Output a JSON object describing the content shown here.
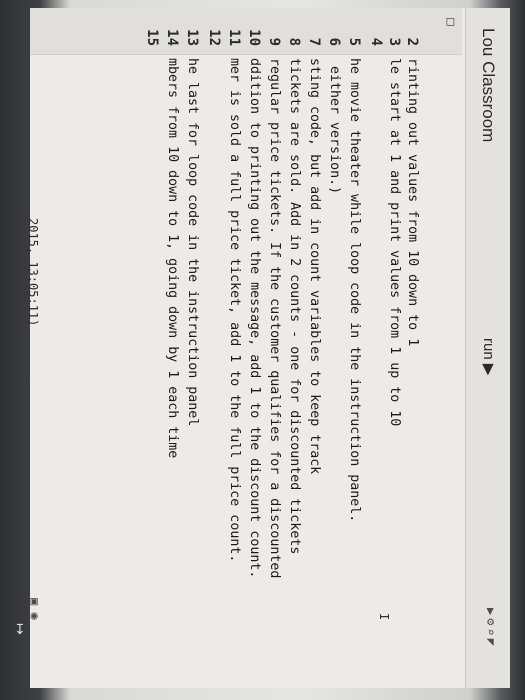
{
  "header": {
    "app_title": "Lou Classroom",
    "run_label": "run ▶",
    "icons": [
      "play-icon",
      "settings-icon",
      "search-icon",
      "network-icon"
    ]
  },
  "gutter": {
    "icon": "app-icon",
    "line_numbers": [
      "2",
      "3",
      "4",
      "5",
      "6",
      "7",
      "8",
      "9",
      "10",
      "11",
      "12",
      "13",
      "14",
      "15"
    ]
  },
  "editor": {
    "lines": [
      "rinting out values from 10 down to 1",
      "le start at 1 and print values from 1 up to 10",
      "",
      "he movie theater while loop code in the instruction panel.",
      " either version.)",
      "sting code, but add in count variables to keep track",
      "tickets are sold. Add in 2 counts - one for discounted tickets",
      "regular price tickets. If the customer qualifies for a discounted",
      "ddition to printing out the message, add 1 to the discount count.",
      "mer is sold a full price ticket, add 1 to the full price count.",
      "",
      "he last for loop code in the instruction panel",
      "mbers from 10 down to 1, going down by 1 each time",
      ""
    ],
    "cursor": "I"
  },
  "status": {
    "timestamp": "2015, 13:05:11)"
  }
}
